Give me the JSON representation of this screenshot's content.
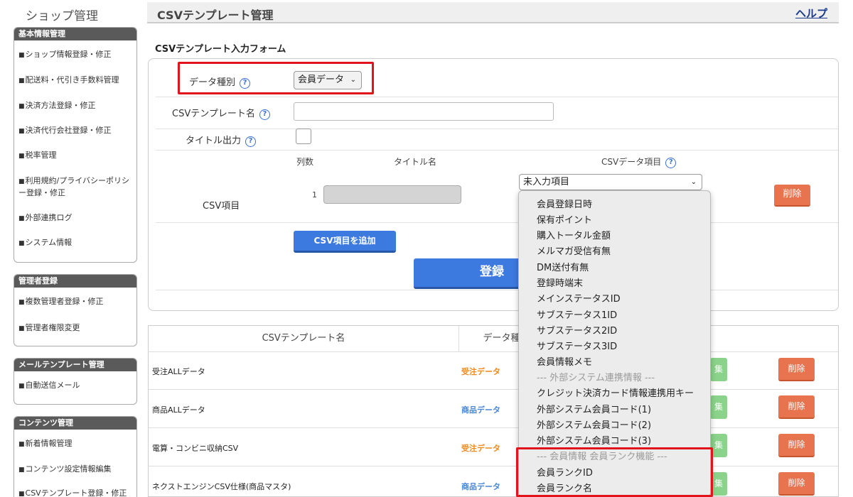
{
  "sidebar": {
    "title": "ショップ管理",
    "groups": [
      {
        "heading": "基本情報管理",
        "items": [
          "ショップ情報登録・修正",
          "配送料・代引き手数料管理",
          "決済方法登録・修正",
          "決済代行会社登録・修正",
          "税率管理",
          "利用規約/プライバシーポリシー登録・修正",
          "外部連携ログ",
          "システム情報"
        ]
      },
      {
        "heading": "管理者登録",
        "items": [
          "複数管理者登録・修正",
          "管理者権限変更"
        ]
      },
      {
        "heading": "メールテンプレート管理",
        "items": [
          "自動送信メール"
        ]
      },
      {
        "heading": "コンテンツ管理",
        "items": [
          "新着情報管理",
          "コンテンツ設定情報編集",
          "CSVテンプレート登録・修正"
        ]
      }
    ]
  },
  "header": {
    "title": "CSVテンプレート管理",
    "help": "ヘルプ"
  },
  "form": {
    "heading": "CSVテンプレート入力フォーム",
    "data_type_label": "データ種別",
    "data_type_value": "会員データ",
    "template_name_label": "CSVテンプレート名",
    "template_name_value": "",
    "title_output_label": "タイトル出力",
    "csv_items_label": "CSV項目",
    "col_count_head": "列数",
    "col_title_head": "タイトル名",
    "col_item_head": "CSVデータ項目",
    "row_number": "1",
    "row_select_value": "未入力項目",
    "row_delete": "削除",
    "add_button": "CSV項目を追加",
    "submit_button": "登録"
  },
  "dropdown": {
    "items": [
      {
        "label": "会員登録日時",
        "group": false
      },
      {
        "label": "保有ポイント",
        "group": false
      },
      {
        "label": "購入トータル金額",
        "group": false
      },
      {
        "label": "メルマガ受信有無",
        "group": false
      },
      {
        "label": "DM送付有無",
        "group": false
      },
      {
        "label": "登録時端末",
        "group": false
      },
      {
        "label": "メインステータスID",
        "group": false
      },
      {
        "label": "サブステータス1ID",
        "group": false
      },
      {
        "label": "サブステータス2ID",
        "group": false
      },
      {
        "label": "サブステータス3ID",
        "group": false
      },
      {
        "label": "会員情報メモ",
        "group": false
      },
      {
        "label": "--- 外部システム連携情報 ---",
        "group": true
      },
      {
        "label": "クレジット決済カード情報連携用キー",
        "group": false
      },
      {
        "label": "外部システム会員コード(1)",
        "group": false
      },
      {
        "label": "外部システム会員コード(2)",
        "group": false
      },
      {
        "label": "外部システム会員コード(3)",
        "group": false
      },
      {
        "label": "--- 会員情報 会員ランク機能 ---",
        "group": true
      },
      {
        "label": "会員ランクID",
        "group": false
      },
      {
        "label": "会員ランク名",
        "group": false
      }
    ]
  },
  "list": {
    "col_name": "CSVテンプレート名",
    "col_type": "データ種",
    "rows": [
      {
        "name": "受注ALLデータ",
        "type": "受注データ",
        "type_color": "#ef8a1b",
        "edit": "集",
        "delete": "削除"
      },
      {
        "name": "商品ALLデータ",
        "type": "商品データ",
        "type_color": "#4a86d8",
        "edit": "集",
        "delete": "削除"
      },
      {
        "name": "電算・コンビニ収納CSV",
        "type": "受注データ",
        "type_color": "#ef8a1b",
        "edit": "集",
        "delete": "削除"
      },
      {
        "name": "ネクストエンジンCSV仕様(商品マスタ)",
        "type": "商品データ",
        "type_color": "#4a86d8",
        "edit": "集",
        "delete": "削除"
      }
    ]
  },
  "colors": {
    "accent_blue": "#3d7ae0",
    "danger": "#e8734f",
    "highlight_red": "#e0141b"
  }
}
